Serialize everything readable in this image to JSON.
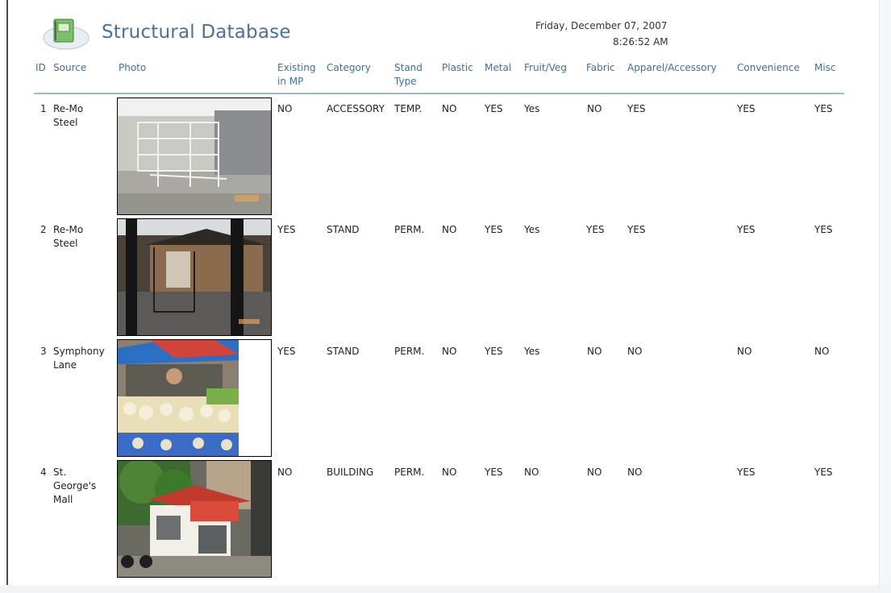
{
  "report": {
    "title": "Structural Database",
    "date": "Friday, December 07, 2007",
    "time": "8:26:52 AM",
    "icon": "report-notebook-icon"
  },
  "columns": {
    "id": "ID",
    "source": "Source",
    "photo": "Photo",
    "existing_line1": "Existing",
    "existing_line2": "in MP",
    "category": "Category",
    "stand_type_line1": "Stand",
    "stand_type_line2": "Type",
    "plastic": "Plastic",
    "metal": "Metal",
    "fruit_veg": "Fruit/Veg",
    "fabric": "Fabric",
    "apparel": "Apparel/Accessory",
    "convenience": "Convenience",
    "misc": "Misc"
  },
  "rows": [
    {
      "id": "1",
      "source_lines": [
        "Re-Mo",
        "Steel"
      ],
      "photo": "metal-display-racks-photo",
      "existing": "NO",
      "category": "ACCESSORY",
      "stand_type": "TEMP.",
      "plastic": "NO",
      "metal": "YES",
      "fruit_veg": "Yes",
      "fabric": "NO",
      "apparel": "YES",
      "convenience": "YES",
      "misc": "YES"
    },
    {
      "id": "2",
      "source_lines": [
        "Re-Mo",
        "Steel"
      ],
      "photo": "steel-frame-stand-photo",
      "existing": "YES",
      "category": "STAND",
      "stand_type": "PERM.",
      "plastic": "NO",
      "metal": "YES",
      "fruit_veg": "Yes",
      "fabric": "YES",
      "apparel": "YES",
      "convenience": "YES",
      "misc": "YES"
    },
    {
      "id": "3",
      "source_lines": [
        "Symphony",
        "Lane"
      ],
      "photo": "market-produce-stall-photo",
      "existing": "YES",
      "category": "STAND",
      "stand_type": "PERM.",
      "plastic": "NO",
      "metal": "YES",
      "fruit_veg": "Yes",
      "fabric": "NO",
      "apparel": "NO",
      "convenience": "NO",
      "misc": "NO"
    },
    {
      "id": "4",
      "source_lines": [
        "St.",
        "George's",
        "Mall"
      ],
      "photo": "kiosk-building-photo",
      "existing": "NO",
      "category": "BUILDING",
      "stand_type": "PERM.",
      "plastic": "NO",
      "metal": "YES",
      "fruit_veg": "NO",
      "fabric": "NO",
      "apparel": "NO",
      "convenience": "YES",
      "misc": "YES"
    }
  ],
  "colors": {
    "title": "#4a6fa0",
    "header_text": "#3f6fa2",
    "header_rule": "#9ab9dc"
  }
}
